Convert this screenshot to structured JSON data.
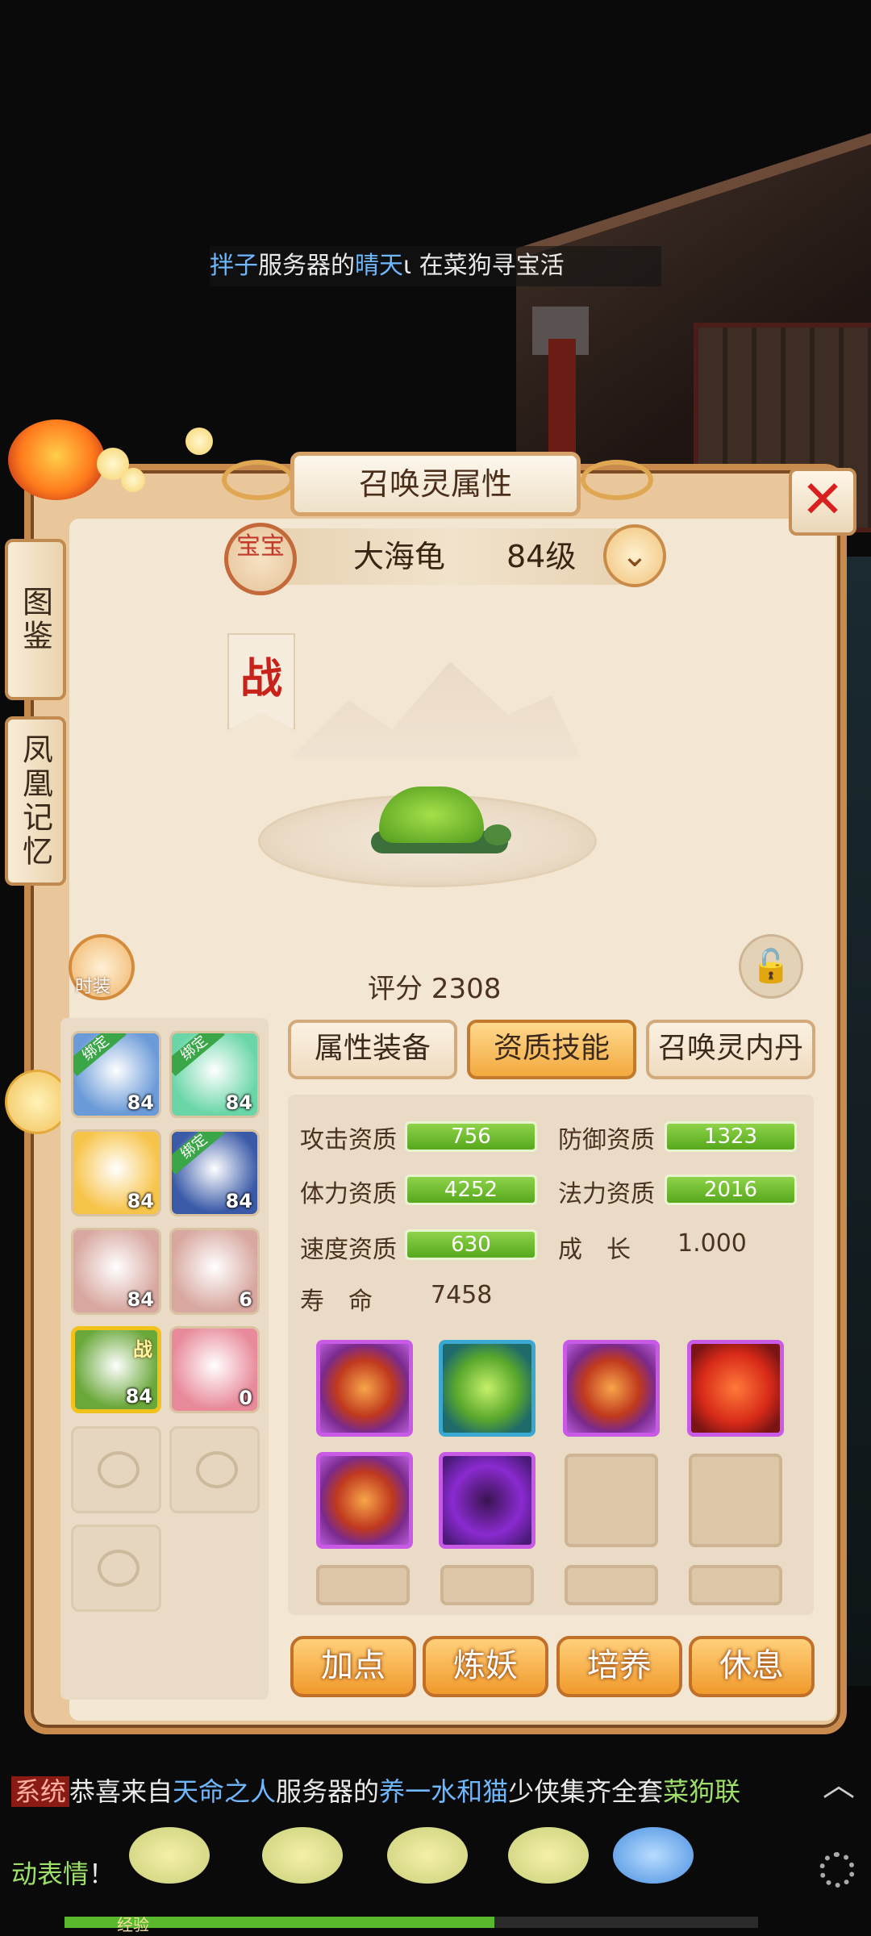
{
  "broadcast_top": {
    "prefix": "拌子",
    "middle": "服务器的",
    "name": "晴天",
    "suffix": "ι 在菜狗寻宝活"
  },
  "panel": {
    "title": "召唤灵属性"
  },
  "side_tabs": [
    "图鉴",
    "凤凰记忆"
  ],
  "pet": {
    "badge": "宝宝",
    "name": "大海龟",
    "level": "84级",
    "battle_flag": "战",
    "score_label": "评分",
    "score": "2308"
  },
  "outfit_label": "时装",
  "pet_slots": [
    {
      "level": "84",
      "bound": "绑定",
      "color": "#6a9ad8"
    },
    {
      "level": "84",
      "bound": "绑定",
      "color": "#6ad6a8"
    },
    {
      "level": "84",
      "bound": "",
      "color": "#f7c44a"
    },
    {
      "level": "84",
      "bound": "绑定",
      "color": "#3a5aa8"
    },
    {
      "level": "84",
      "bound": "",
      "color": "#d8a8a0"
    },
    {
      "level": "6",
      "bound": "",
      "color": "#d8a8a0"
    },
    {
      "level": "84",
      "bound": "",
      "tag": "战",
      "color": "#6aa83a"
    },
    {
      "level": "0",
      "bound": "",
      "color": "#e88a9a"
    }
  ],
  "tabs": [
    "属性装备",
    "资质技能",
    "召唤灵内丹"
  ],
  "selected_tab": "资质技能",
  "stats": {
    "attack_label": "攻击资质",
    "attack": "756",
    "defense_label": "防御资质",
    "defense": "1323",
    "stamina_label": "体力资质",
    "stamina": "4252",
    "magic_label": "法力资质",
    "magic": "2016",
    "speed_label": "速度资质",
    "speed": "630",
    "growth_label": "成　长",
    "growth": "1.000",
    "life_label": "寿　命",
    "life": "7458"
  },
  "actions": [
    "加点",
    "炼妖",
    "培养",
    "休息"
  ],
  "chat": {
    "sys_tag": "系统",
    "line1_a": "恭喜来自",
    "line1_server": "天命之人",
    "line1_b": "服务器的",
    "line1_name": "养一水和猫",
    "line1_c": "少侠集齐全套",
    "line1_item": "菜狗联",
    "line2_item": "动表情",
    "line2_end": "！"
  },
  "exp_label": "经验",
  "exp_progress": 0.62
}
